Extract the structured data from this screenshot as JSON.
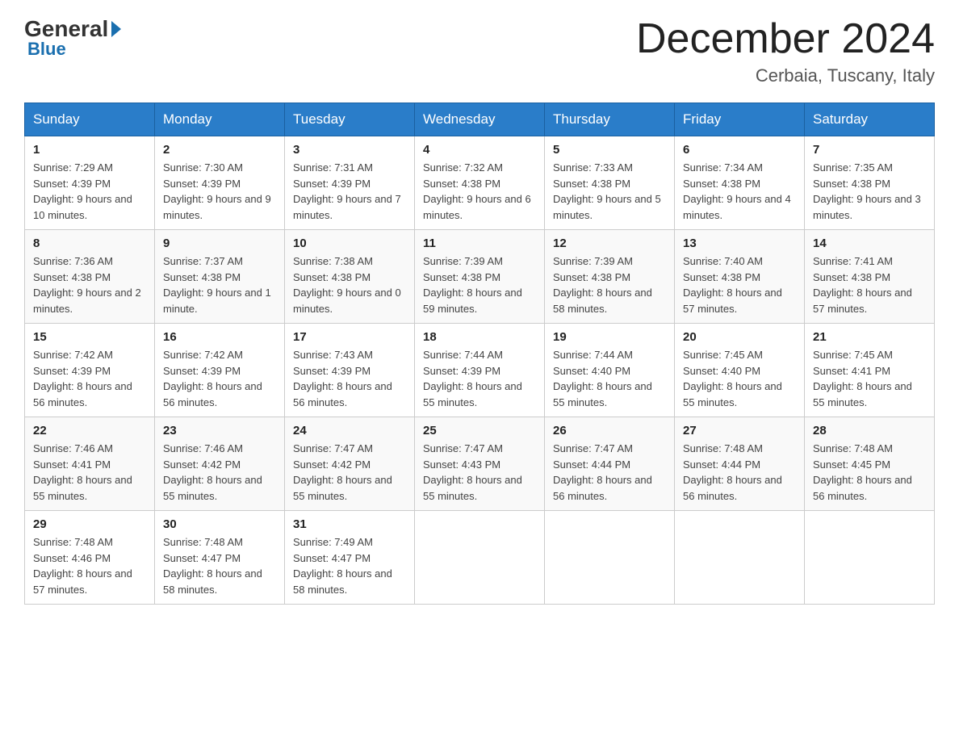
{
  "header": {
    "logo_general": "General",
    "logo_blue": "Blue",
    "title": "December 2024",
    "location": "Cerbaia, Tuscany, Italy"
  },
  "calendar": {
    "columns": [
      "Sunday",
      "Monday",
      "Tuesday",
      "Wednesday",
      "Thursday",
      "Friday",
      "Saturday"
    ],
    "weeks": [
      [
        {
          "day": "1",
          "sunrise": "7:29 AM",
          "sunset": "4:39 PM",
          "daylight": "9 hours and 10 minutes."
        },
        {
          "day": "2",
          "sunrise": "7:30 AM",
          "sunset": "4:39 PM",
          "daylight": "9 hours and 9 minutes."
        },
        {
          "day": "3",
          "sunrise": "7:31 AM",
          "sunset": "4:39 PM",
          "daylight": "9 hours and 7 minutes."
        },
        {
          "day": "4",
          "sunrise": "7:32 AM",
          "sunset": "4:38 PM",
          "daylight": "9 hours and 6 minutes."
        },
        {
          "day": "5",
          "sunrise": "7:33 AM",
          "sunset": "4:38 PM",
          "daylight": "9 hours and 5 minutes."
        },
        {
          "day": "6",
          "sunrise": "7:34 AM",
          "sunset": "4:38 PM",
          "daylight": "9 hours and 4 minutes."
        },
        {
          "day": "7",
          "sunrise": "7:35 AM",
          "sunset": "4:38 PM",
          "daylight": "9 hours and 3 minutes."
        }
      ],
      [
        {
          "day": "8",
          "sunrise": "7:36 AM",
          "sunset": "4:38 PM",
          "daylight": "9 hours and 2 minutes."
        },
        {
          "day": "9",
          "sunrise": "7:37 AM",
          "sunset": "4:38 PM",
          "daylight": "9 hours and 1 minute."
        },
        {
          "day": "10",
          "sunrise": "7:38 AM",
          "sunset": "4:38 PM",
          "daylight": "9 hours and 0 minutes."
        },
        {
          "day": "11",
          "sunrise": "7:39 AM",
          "sunset": "4:38 PM",
          "daylight": "8 hours and 59 minutes."
        },
        {
          "day": "12",
          "sunrise": "7:39 AM",
          "sunset": "4:38 PM",
          "daylight": "8 hours and 58 minutes."
        },
        {
          "day": "13",
          "sunrise": "7:40 AM",
          "sunset": "4:38 PM",
          "daylight": "8 hours and 57 minutes."
        },
        {
          "day": "14",
          "sunrise": "7:41 AM",
          "sunset": "4:38 PM",
          "daylight": "8 hours and 57 minutes."
        }
      ],
      [
        {
          "day": "15",
          "sunrise": "7:42 AM",
          "sunset": "4:39 PM",
          "daylight": "8 hours and 56 minutes."
        },
        {
          "day": "16",
          "sunrise": "7:42 AM",
          "sunset": "4:39 PM",
          "daylight": "8 hours and 56 minutes."
        },
        {
          "day": "17",
          "sunrise": "7:43 AM",
          "sunset": "4:39 PM",
          "daylight": "8 hours and 56 minutes."
        },
        {
          "day": "18",
          "sunrise": "7:44 AM",
          "sunset": "4:39 PM",
          "daylight": "8 hours and 55 minutes."
        },
        {
          "day": "19",
          "sunrise": "7:44 AM",
          "sunset": "4:40 PM",
          "daylight": "8 hours and 55 minutes."
        },
        {
          "day": "20",
          "sunrise": "7:45 AM",
          "sunset": "4:40 PM",
          "daylight": "8 hours and 55 minutes."
        },
        {
          "day": "21",
          "sunrise": "7:45 AM",
          "sunset": "4:41 PM",
          "daylight": "8 hours and 55 minutes."
        }
      ],
      [
        {
          "day": "22",
          "sunrise": "7:46 AM",
          "sunset": "4:41 PM",
          "daylight": "8 hours and 55 minutes."
        },
        {
          "day": "23",
          "sunrise": "7:46 AM",
          "sunset": "4:42 PM",
          "daylight": "8 hours and 55 minutes."
        },
        {
          "day": "24",
          "sunrise": "7:47 AM",
          "sunset": "4:42 PM",
          "daylight": "8 hours and 55 minutes."
        },
        {
          "day": "25",
          "sunrise": "7:47 AM",
          "sunset": "4:43 PM",
          "daylight": "8 hours and 55 minutes."
        },
        {
          "day": "26",
          "sunrise": "7:47 AM",
          "sunset": "4:44 PM",
          "daylight": "8 hours and 56 minutes."
        },
        {
          "day": "27",
          "sunrise": "7:48 AM",
          "sunset": "4:44 PM",
          "daylight": "8 hours and 56 minutes."
        },
        {
          "day": "28",
          "sunrise": "7:48 AM",
          "sunset": "4:45 PM",
          "daylight": "8 hours and 56 minutes."
        }
      ],
      [
        {
          "day": "29",
          "sunrise": "7:48 AM",
          "sunset": "4:46 PM",
          "daylight": "8 hours and 57 minutes."
        },
        {
          "day": "30",
          "sunrise": "7:48 AM",
          "sunset": "4:47 PM",
          "daylight": "8 hours and 58 minutes."
        },
        {
          "day": "31",
          "sunrise": "7:49 AM",
          "sunset": "4:47 PM",
          "daylight": "8 hours and 58 minutes."
        },
        null,
        null,
        null,
        null
      ]
    ]
  }
}
